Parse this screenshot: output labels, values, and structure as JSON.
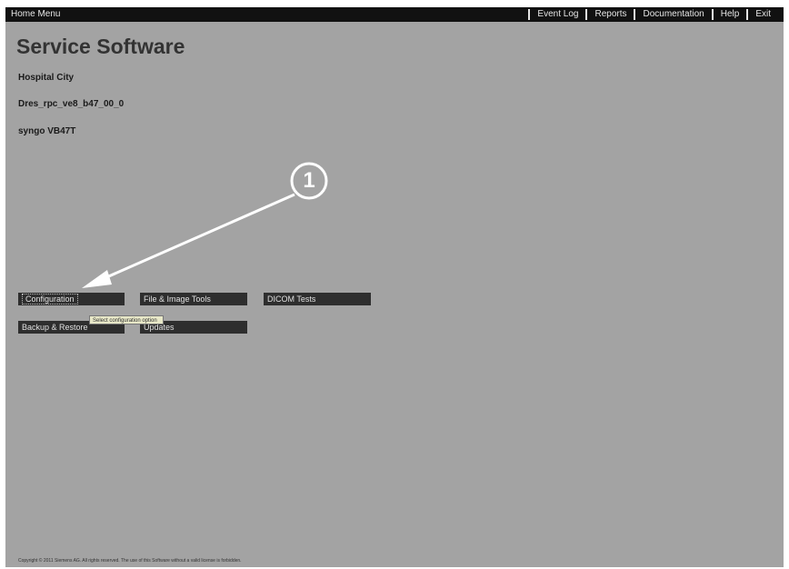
{
  "topbar": {
    "home": "Home Menu",
    "links": [
      "Event Log",
      "Reports",
      "Documentation",
      "Help",
      "Exit"
    ]
  },
  "page": {
    "title": "Service Software",
    "site": "Hospital City",
    "host": "Dres_rpc_ve8_b47_00_0",
    "version": "syngo VB47T"
  },
  "buttons": {
    "configuration": "Configuration",
    "file_image_tools": "File & Image Tools",
    "dicom_tests": "DICOM Tests",
    "backup_restore": "Backup & Restore",
    "updates": "Updates"
  },
  "tooltip": "Select configuration option",
  "callout": {
    "number": "1"
  },
  "footer": "Copyright © 2011 Siemens AG. All rights reserved. The use of this Software without a valid license is forbidden.",
  "colors": {
    "background": "#a3a3a3",
    "topbar": "#111111",
    "button": "#2e2e2e",
    "callout": "#ffffff"
  }
}
